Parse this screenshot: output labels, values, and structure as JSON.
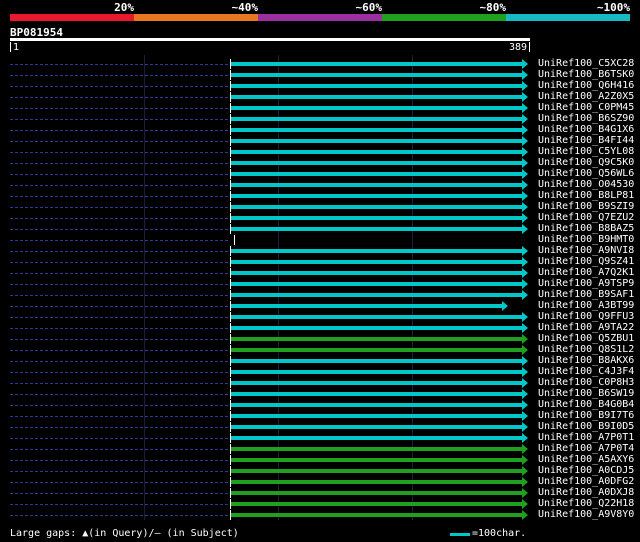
{
  "legend": {
    "labels": [
      "20%",
      "~40%",
      "~60%",
      "~80%",
      "~100%"
    ],
    "colors": [
      "#e8192c",
      "#e87722",
      "#9b30a0",
      "#1fa01f",
      "#17b9c3"
    ]
  },
  "query": {
    "id": "BP081954",
    "start": "1",
    "end": "389"
  },
  "hits": [
    {
      "name": "UniRef100_C5XC28",
      "color": "cyan"
    },
    {
      "name": "UniRef100_B6TSK0",
      "color": "cyan"
    },
    {
      "name": "UniRef100_Q6H416",
      "color": "cyan"
    },
    {
      "name": "UniRef100_A2Z0X5",
      "color": "cyan"
    },
    {
      "name": "UniRef100_C0PM45",
      "color": "cyan"
    },
    {
      "name": "UniRef100_B6SZ90",
      "color": "cyan"
    },
    {
      "name": "UniRef100_B4G1X6",
      "color": "cyan"
    },
    {
      "name": "UniRef100_B4FI44",
      "color": "cyan"
    },
    {
      "name": "UniRef100_C5YL08",
      "color": "cyan"
    },
    {
      "name": "UniRef100_Q9C5K0",
      "color": "cyan"
    },
    {
      "name": "UniRef100_Q56WL6",
      "color": "cyan"
    },
    {
      "name": "UniRef100_O04530",
      "color": "cyan"
    },
    {
      "name": "UniRef100_B8LP81",
      "color": "cyan"
    },
    {
      "name": "UniRef100_B9SZI9",
      "color": "cyan"
    },
    {
      "name": "UniRef100_Q7EZU2",
      "color": "cyan"
    },
    {
      "name": "UniRef100_B8BAZ5",
      "color": "cyan"
    },
    {
      "name": "UniRef100_B9HMT0",
      "color": "none"
    },
    {
      "name": "UniRef100_A9NVI8",
      "color": "cyan"
    },
    {
      "name": "UniRef100_Q9SZ41",
      "color": "cyan"
    },
    {
      "name": "UniRef100_A7Q2K1",
      "color": "cyan"
    },
    {
      "name": "UniRef100_A9TSP9",
      "color": "cyan"
    },
    {
      "name": "UniRef100_B9SAF1",
      "color": "cyan"
    },
    {
      "name": "UniRef100_A3BT99",
      "color": "cyan-short"
    },
    {
      "name": "UniRef100_Q9FFU3",
      "color": "cyan"
    },
    {
      "name": "UniRef100_A9TA22",
      "color": "cyan"
    },
    {
      "name": "UniRef100_Q5ZBU1",
      "color": "green"
    },
    {
      "name": "UniRef100_Q8S1L2",
      "color": "green"
    },
    {
      "name": "UniRef100_B8AKX6",
      "color": "cyan"
    },
    {
      "name": "UniRef100_C4J3F4",
      "color": "cyan"
    },
    {
      "name": "UniRef100_C0P8H3",
      "color": "cyan"
    },
    {
      "name": "UniRef100_B6SW19",
      "color": "cyan"
    },
    {
      "name": "UniRef100_B4G0B4",
      "color": "cyan"
    },
    {
      "name": "UniRef100_B9I7T6",
      "color": "cyan"
    },
    {
      "name": "UniRef100_B9I0D5",
      "color": "cyan"
    },
    {
      "name": "UniRef100_A7P0T1",
      "color": "cyan"
    },
    {
      "name": "UniRef100_A7P0T4",
      "color": "green"
    },
    {
      "name": "UniRef100_A5AXY6",
      "color": "green"
    },
    {
      "name": "UniRef100_A0CDJ5",
      "color": "green"
    },
    {
      "name": "UniRef100_A0DFG2",
      "color": "green"
    },
    {
      "name": "UniRef100_A0DXJ8",
      "color": "green"
    },
    {
      "name": "UniRef100_Q22H18",
      "color": "green"
    },
    {
      "name": "UniRef100_A9V8Y0",
      "color": "green"
    }
  ],
  "footer": {
    "gaps_text": "Large gaps: ▲(in Query)/— (in Subject)",
    "scale_text": "=100char."
  }
}
